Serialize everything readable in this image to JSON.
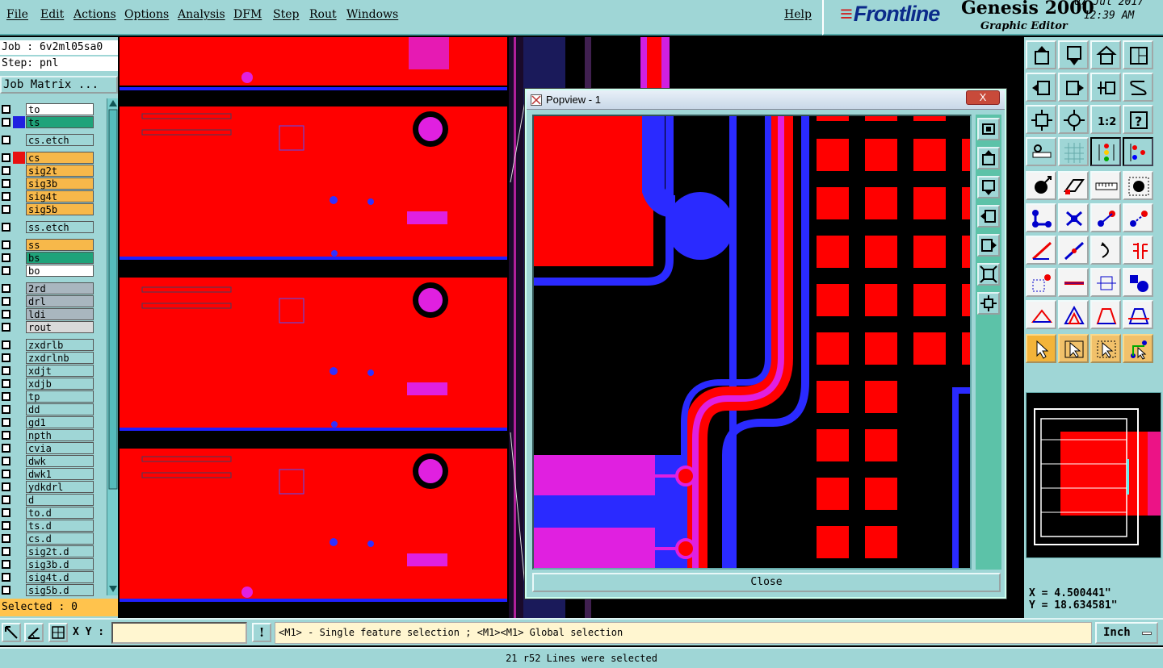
{
  "menu": {
    "items": [
      "File",
      "Edit",
      "Actions",
      "Options",
      "Analysis",
      "DFM",
      "Step",
      "Rout",
      "Windows"
    ],
    "help": "Help"
  },
  "brand": {
    "logo": "Frontline",
    "product": "Genesis 2000",
    "subtitle": "Graphic Editor",
    "date": "07 Jul 2017",
    "time": "12:39 AM"
  },
  "job": {
    "job_line": "Job : 6v2ml05sa0",
    "step_line": "Step: pnl",
    "matrix_button": "Job Matrix ..."
  },
  "layers": [
    {
      "name": "to",
      "bg": "#ffffff",
      "swatch": ""
    },
    {
      "name": "ts",
      "bg": "#1fa37a",
      "swatch": "#2020e0"
    },
    {
      "name": "cs.etch",
      "bg": "#9fd6d6",
      "swatch": ""
    },
    {
      "name": "cs",
      "bg": "#f7b84a",
      "swatch": "#e81010"
    },
    {
      "name": "sig2t",
      "bg": "#f7b84a",
      "swatch": ""
    },
    {
      "name": "sig3b",
      "bg": "#f7b84a",
      "swatch": ""
    },
    {
      "name": "sig4t",
      "bg": "#f7b84a",
      "swatch": ""
    },
    {
      "name": "sig5b",
      "bg": "#f7b84a",
      "swatch": ""
    },
    {
      "name": "ss.etch",
      "bg": "#9fd6d6",
      "swatch": ""
    },
    {
      "name": "ss",
      "bg": "#f7b84a",
      "swatch": ""
    },
    {
      "name": "bs",
      "bg": "#1fa37a",
      "swatch": ""
    },
    {
      "name": "bo",
      "bg": "#ffffff",
      "swatch": ""
    },
    {
      "name": "2rd",
      "bg": "#a9b6bf",
      "swatch": ""
    },
    {
      "name": "drl",
      "bg": "#a9b6bf",
      "swatch": ""
    },
    {
      "name": "ldi",
      "bg": "#a9b6bf",
      "swatch": ""
    },
    {
      "name": "rout",
      "bg": "#d9d9d9",
      "swatch": ""
    },
    {
      "name": "zxdrlb",
      "bg": "#9fd6d6",
      "swatch": ""
    },
    {
      "name": "zxdrlnb",
      "bg": "#9fd6d6",
      "swatch": ""
    },
    {
      "name": "xdjt",
      "bg": "#9fd6d6",
      "swatch": ""
    },
    {
      "name": "xdjb",
      "bg": "#9fd6d6",
      "swatch": ""
    },
    {
      "name": "tp",
      "bg": "#9fd6d6",
      "swatch": ""
    },
    {
      "name": "dd",
      "bg": "#9fd6d6",
      "swatch": ""
    },
    {
      "name": "gd1",
      "bg": "#9fd6d6",
      "swatch": ""
    },
    {
      "name": "npth",
      "bg": "#9fd6d6",
      "swatch": ""
    },
    {
      "name": "cvia",
      "bg": "#9fd6d6",
      "swatch": ""
    },
    {
      "name": "dwk",
      "bg": "#9fd6d6",
      "swatch": ""
    },
    {
      "name": "dwk1",
      "bg": "#9fd6d6",
      "swatch": ""
    },
    {
      "name": "ydkdrl",
      "bg": "#9fd6d6",
      "swatch": ""
    },
    {
      "name": "d",
      "bg": "#9fd6d6",
      "swatch": ""
    },
    {
      "name": "to.d",
      "bg": "#9fd6d6",
      "swatch": ""
    },
    {
      "name": "ts.d",
      "bg": "#9fd6d6",
      "swatch": ""
    },
    {
      "name": "cs.d",
      "bg": "#9fd6d6",
      "swatch": ""
    },
    {
      "name": "sig2t.d",
      "bg": "#9fd6d6",
      "swatch": ""
    },
    {
      "name": "sig3b.d",
      "bg": "#9fd6d6",
      "swatch": ""
    },
    {
      "name": "sig4t.d",
      "bg": "#9fd6d6",
      "swatch": ""
    },
    {
      "name": "sig5b.d",
      "bg": "#9fd6d6",
      "swatch": ""
    }
  ],
  "selected": "Selected : 0",
  "popview": {
    "title": "Popview - 1",
    "close_x": "X",
    "close_button": "Close"
  },
  "coords": {
    "x": "X = 4.500441\"",
    "y": "Y = 18.634581\""
  },
  "command": {
    "xy_label": "X Y :",
    "xy_value": "",
    "warn": "!",
    "message": "<M1> - Single feature selection ; <M1><M1> Global selection",
    "units": "Inch"
  },
  "status": "21 r52 Lines were selected",
  "colors": {
    "copper_top": "#ff0000",
    "copper_bottom": "#2020ff",
    "overlap": "#e020e0",
    "panel_bg": "#9fd6d6"
  }
}
